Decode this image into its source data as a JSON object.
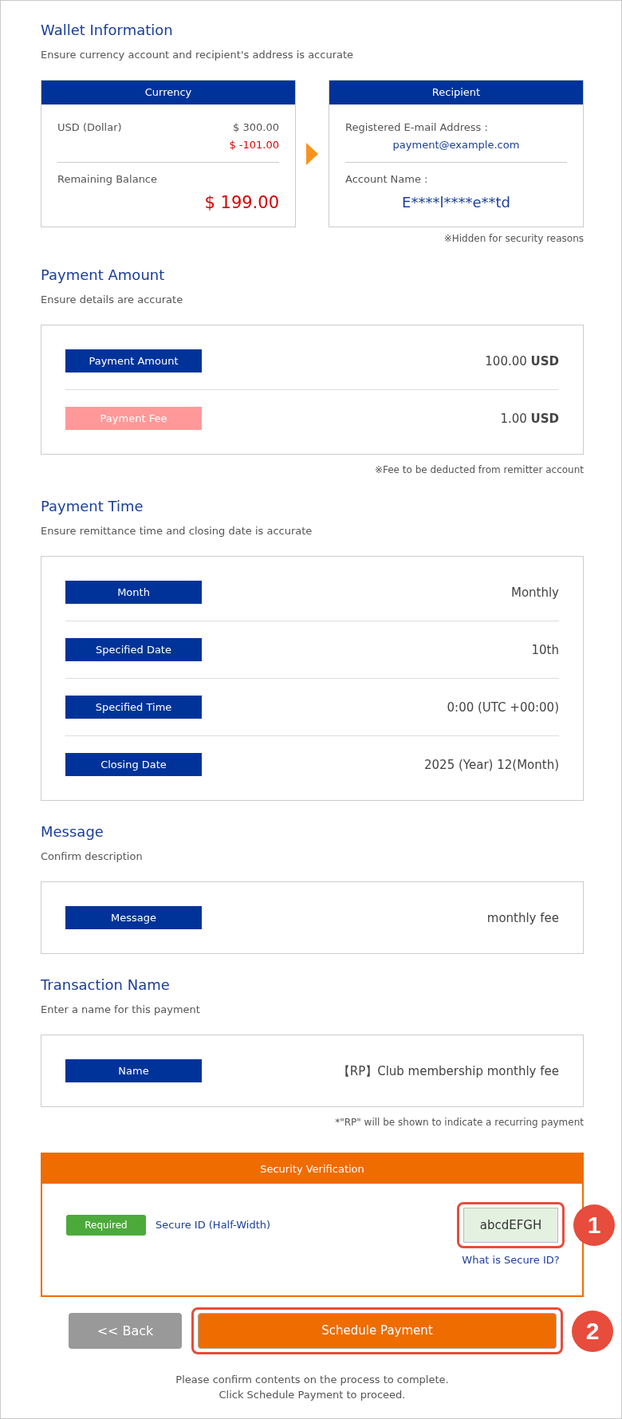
{
  "wallet": {
    "title": "Wallet Information",
    "subtitle": "Ensure currency account and recipient's address is accurate",
    "currency": {
      "header": "Currency",
      "account": "USD (Dollar)",
      "amount": "$ 300.00",
      "deduction": "$ -101.00",
      "remaining_label": "Remaining Balance",
      "remaining": "$ 199.00"
    },
    "recipient": {
      "header": "Recipient",
      "email_label": "Registered E-mail Address :",
      "email": "payment@example.com",
      "name_label": "Account Name :",
      "account_name": "E****l****e**td"
    },
    "note": "※Hidden for security reasons"
  },
  "sections": [
    {
      "title": "Payment Amount",
      "subtitle": "Ensure details are accurate",
      "rows": [
        {
          "kind": "standard",
          "label": "Payment Amount",
          "value": "100.00 **USD**"
        },
        {
          "kind": "fee",
          "label": "Payment Fee",
          "value": "1.00 **USD**"
        }
      ],
      "note": "※Fee to be deducted from remitter account"
    },
    {
      "title": "Payment Time",
      "subtitle": "Ensure remittance time and closing date is accurate",
      "rows": [
        {
          "kind": "standard",
          "label": "Month",
          "value": "Monthly"
        },
        {
          "kind": "standard",
          "label": "Specified Date",
          "value": "10th"
        },
        {
          "kind": "standard",
          "label": "Specified Time",
          "value": "0:00 (UTC +00:00)"
        },
        {
          "kind": "standard",
          "label": "Closing Date",
          "value": "2025 (Year) 12(Month)"
        }
      ]
    },
    {
      "title": "Message",
      "subtitle": "Confirm description",
      "rows": [
        {
          "kind": "standard",
          "label": "Message",
          "value": "monthly fee"
        }
      ]
    },
    {
      "title": "Transaction Name",
      "subtitle": "Enter a name for this payment",
      "rows": [
        {
          "kind": "standard",
          "label": "Name",
          "value": "【RP】Club membership monthly fee"
        }
      ],
      "note": "*\"RP\" will be shown to indicate a recurring payment"
    }
  ],
  "security": {
    "header": "Security Verification",
    "badge": "Required",
    "label": "Secure ID (Half-Width)",
    "secure_id": "abcdEFGH",
    "help_link": "What is Secure ID?",
    "callout": "1"
  },
  "actions": {
    "back": "<< Back",
    "submit": "Schedule Payment",
    "callout": "2"
  },
  "footer": [
    "Please confirm contents on the process to complete.",
    "Click Schedule Payment to proceed."
  ]
}
